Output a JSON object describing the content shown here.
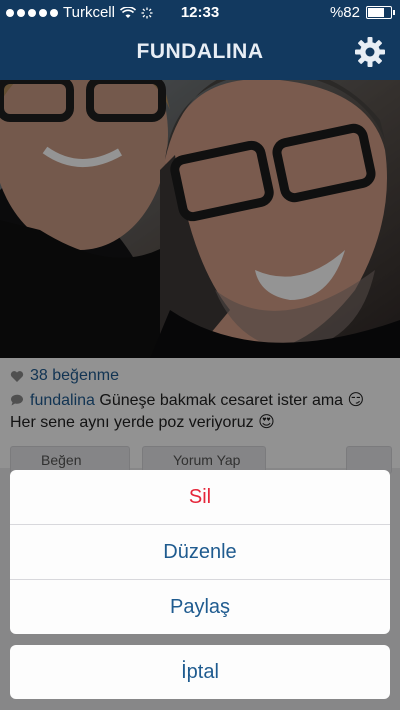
{
  "status_bar": {
    "carrier": "Turkcell",
    "time": "12:33",
    "battery": "%82",
    "battery_level": 0.82
  },
  "nav": {
    "title": "FUNDALINA",
    "settings_icon": "gear-icon"
  },
  "post": {
    "likes": "38 beğenme",
    "caption_user": "fundalina",
    "caption_text": "Güneşe bakmak cesaret ister ama 😏 Her sene aynı yerde poz veriyoruz 😍",
    "like_button": "Beğen",
    "comment_button": "Yorum Yap"
  },
  "action_sheet": {
    "delete": "Sil",
    "edit": "Düzenle",
    "share": "Paylaş",
    "cancel": "İptal"
  },
  "colors": {
    "nav_bg": "#12395f",
    "link_blue": "#1f5b8f",
    "delete_red": "#e5263a"
  }
}
